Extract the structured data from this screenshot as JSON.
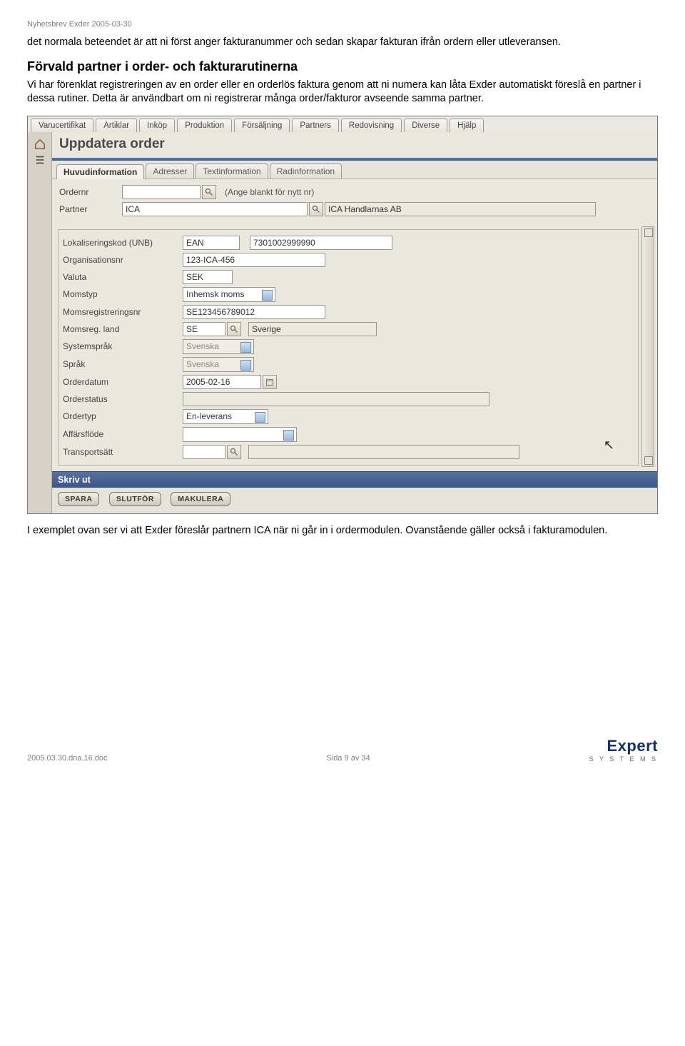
{
  "doc": {
    "header_note": "Nyhetsbrev Exder 2005-03-30",
    "para1": "det normala beteendet är att ni först anger fakturanummer och sedan skapar fakturan ifrån ordern eller utleveransen.",
    "h2": "Förvald partner i order- och fakturarutinerna",
    "para2": "Vi har förenklat registreringen av en order eller en orderlös faktura genom att ni numera kan låta Exder automatiskt föreslå en partner i dessa rutiner. Detta är användbart om ni registrerar många order/fakturor avseende samma partner.",
    "para3": "I exemplet ovan ser vi att Exder föreslår partnern ICA när ni går in i ordermodulen. Ovanstående gäller också i fakturamodulen."
  },
  "menu": [
    "Varucertifikat",
    "Artiklar",
    "Inköp",
    "Produktion",
    "Försäljning",
    "Partners",
    "Redovisning",
    "Diverse",
    "Hjälp"
  ],
  "screen": {
    "title": "Uppdatera order",
    "tabs": [
      "Huvudinformation",
      "Adresser",
      "Textinformation",
      "Radinformation"
    ],
    "top": {
      "ordernr_label": "Ordernr",
      "ordernr_hint": "(Ange blankt för nytt nr)",
      "partner_label": "Partner",
      "partner_value": "ICA",
      "partner_name": "ICA Handlarnas AB"
    },
    "fields": {
      "unb_label": "Lokaliseringskod (UNB)",
      "unb_code": "EAN",
      "unb_value": "7301002999990",
      "org_label": "Organisationsnr",
      "org_value": "123-ICA-456",
      "valuta_label": "Valuta",
      "valuta_value": "SEK",
      "momstyp_label": "Momstyp",
      "momstyp_value": "Inhemsk moms",
      "momsreg_label": "Momsregistreringsnr",
      "momsreg_value": "SE123456789012",
      "momsland_label": "Momsreg. land",
      "momsland_code": "SE",
      "momsland_name": "Sverige",
      "syssprak_label": "Systemspråk",
      "syssprak_value": "Svenska",
      "sprak_label": "Språk",
      "sprak_value": "Svenska",
      "orderdatum_label": "Orderdatum",
      "orderdatum_value": "2005-02-16",
      "orderstatus_label": "Orderstatus",
      "ordertyp_label": "Ordertyp",
      "ordertyp_value": "En-leverans",
      "affar_label": "Affärsflöde",
      "transport_label": "Transportsätt"
    },
    "print_label": "Skriv ut",
    "buttons": [
      "SPARA",
      "SLUTFÖR",
      "MAKULERA"
    ]
  },
  "footer": {
    "left": "2005.03.30.dna.16.doc",
    "mid": "Sida 9 av 34",
    "logo_brand": "Expert",
    "logo_tag": "S Y S T E M S"
  }
}
